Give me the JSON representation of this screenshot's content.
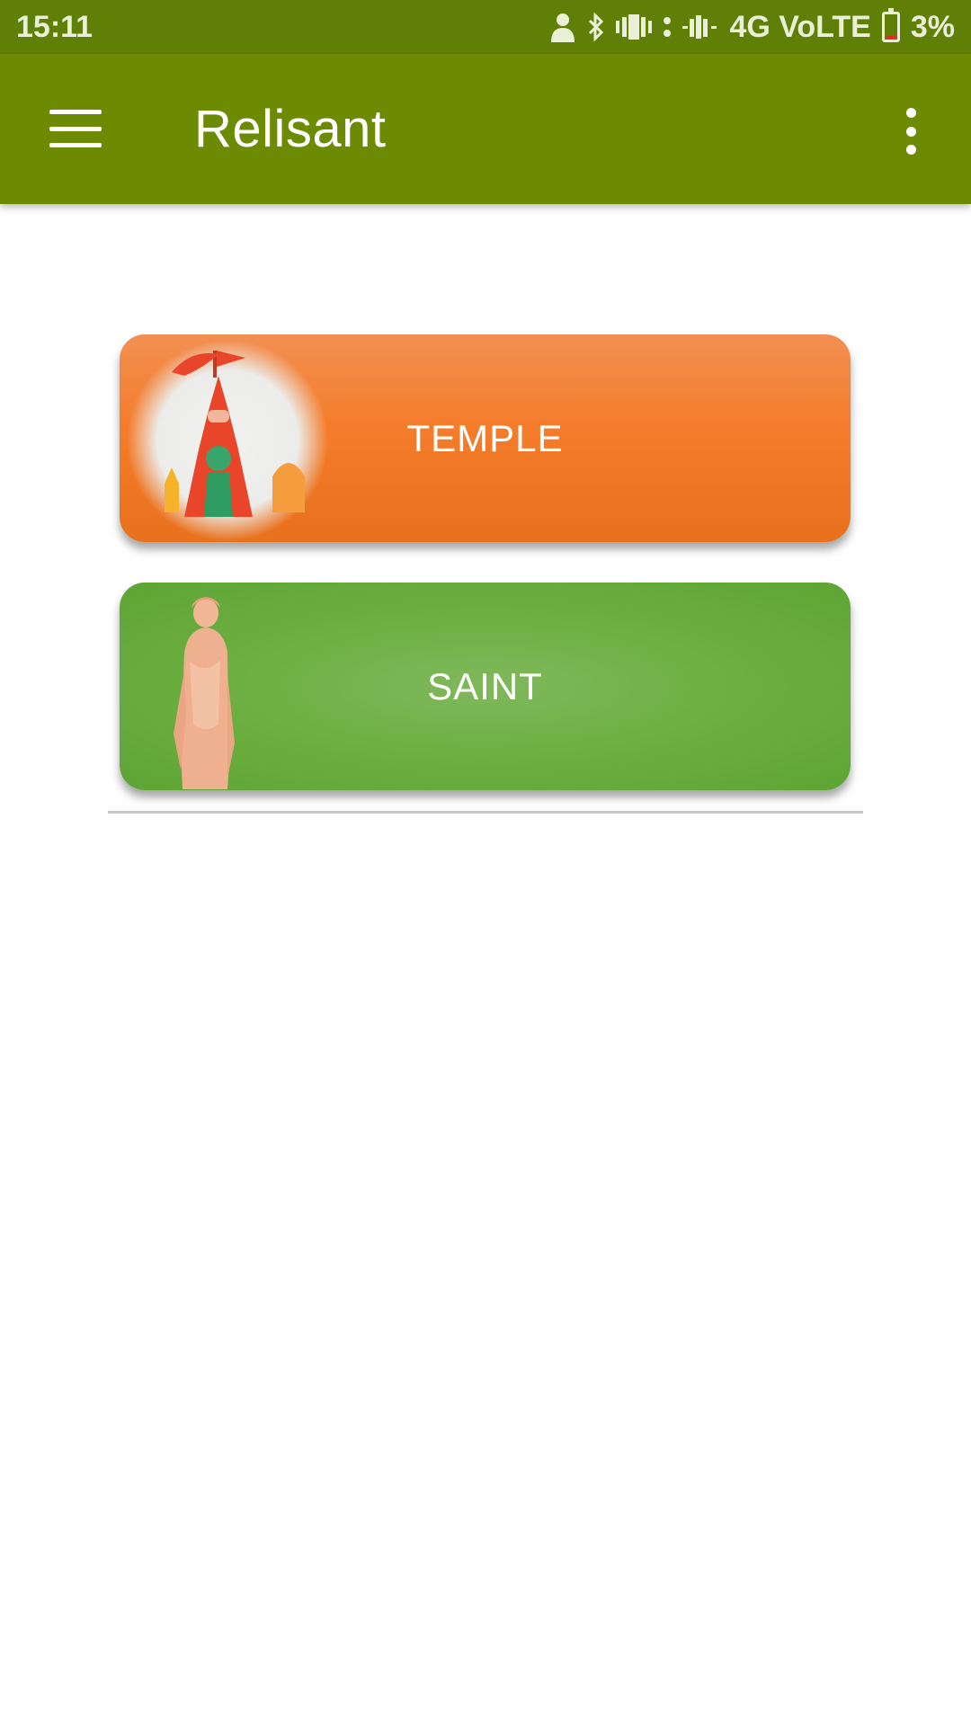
{
  "status_bar": {
    "time": "15:11",
    "network": "4G VoLTE",
    "battery": "3%"
  },
  "app_bar": {
    "title": "Relisant"
  },
  "cards": [
    {
      "label": "TEMPLE",
      "color": "#f47c2a"
    },
    {
      "label": "SAINT",
      "color": "#6eb043"
    }
  ],
  "theme": {
    "status_bar_color": "#5f7f06",
    "app_bar_color": "#6c8a02"
  }
}
